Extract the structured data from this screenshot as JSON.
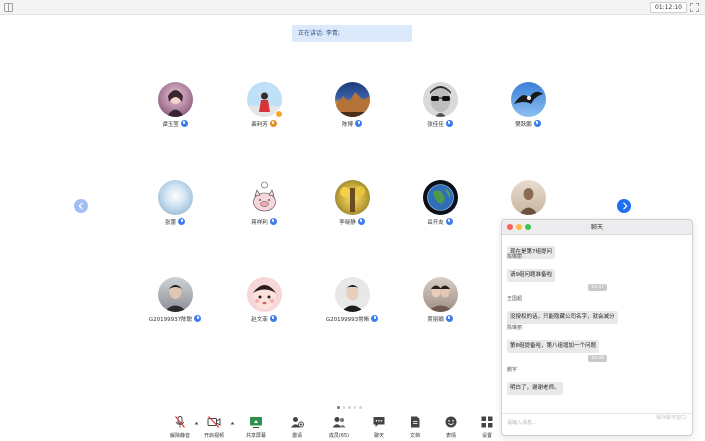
{
  "topbar": {
    "timer": "01:12:10"
  },
  "speaking": {
    "label": "正在讲话: 李青;"
  },
  "participants": [
    {
      "name": "谭玉莹"
    },
    {
      "name": "裴利芳"
    },
    {
      "name": "陈博"
    },
    {
      "name": "张佳佳"
    },
    {
      "name": "樊跃鹏"
    },
    {
      "name": "张蕾"
    },
    {
      "name": "蒋祥利"
    },
    {
      "name": "李晓静"
    },
    {
      "name": "岳开友"
    },
    {
      "name": "G20199937陈聪"
    },
    {
      "name": "赵文菲"
    },
    {
      "name": "G20199993常晰"
    },
    {
      "name": "贾丽娟"
    }
  ],
  "pagination": {
    "count": 5,
    "active": 0
  },
  "toolbar": {
    "unmute": "解除静音",
    "start_video": "开启视频",
    "share_screen": "共享屏幕",
    "invite": "邀请",
    "members": "成员(65)",
    "chat": "聊天",
    "docs": "文档",
    "emoji": "表情",
    "settings": "设置"
  },
  "chat": {
    "title": "聊天",
    "messages": [
      {
        "sender": "",
        "text": "现在是第7组提问"
      },
      {
        "sender": "陈琳丽",
        "text": "请9组问题准备啦"
      },
      {
        "time": "10:47"
      },
      {
        "sender": "王国超",
        "text": "没授权的话，只能隐藏公司名字，就会减分"
      },
      {
        "sender": "陈琳丽",
        "text": "第8组提备哈，第八组增加一个问题"
      },
      {
        "time": "10:48"
      },
      {
        "sender": "鹏宇",
        "text": "明白了，谢谢老师。"
      }
    ],
    "save_link": "保存聊天窗口",
    "input_placeholder": "请输入消息..."
  },
  "colors": {
    "accent": "#1e6ff1",
    "mic_badge": "#3b7cf0"
  }
}
